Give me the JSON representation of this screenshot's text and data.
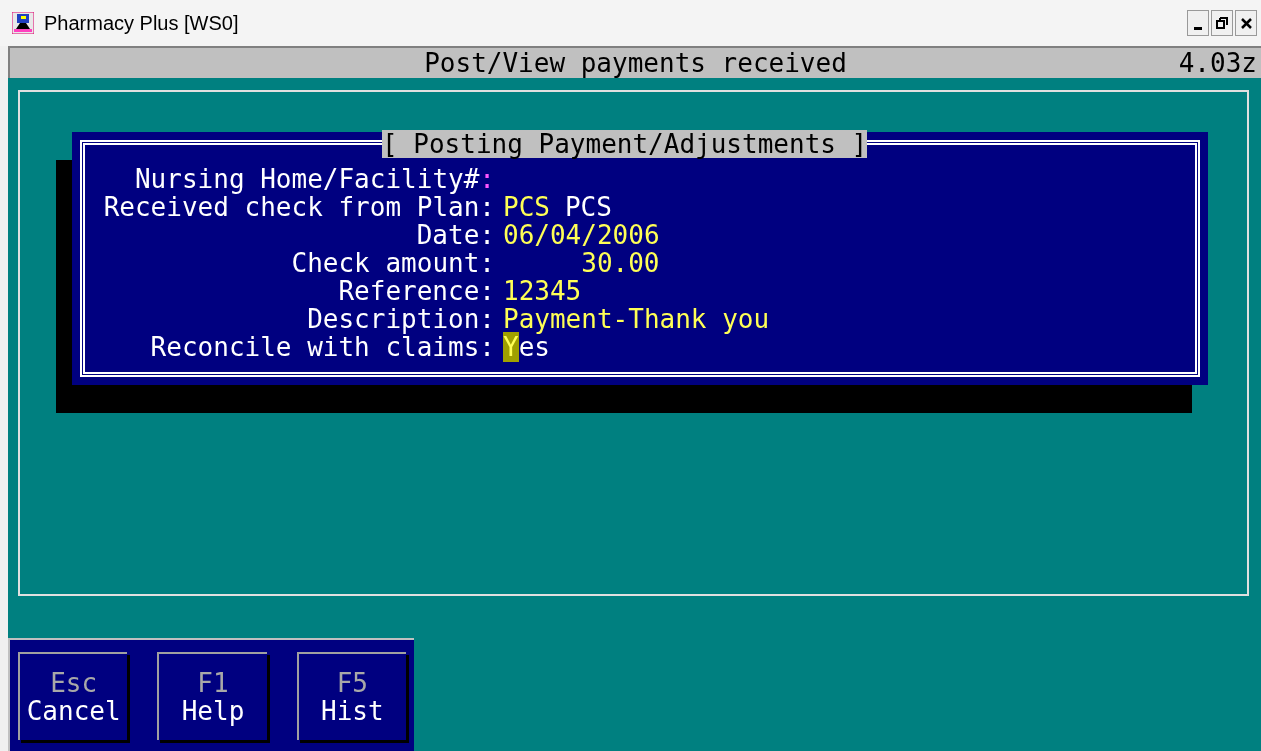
{
  "window": {
    "title": "Pharmacy Plus [WS0]"
  },
  "header": {
    "title": "Post/View payments received",
    "version": "4.03z"
  },
  "dialog": {
    "title": "[ Posting Payment/Adjustments ]",
    "fields": [
      {
        "label": "Nursing Home/Facility#:",
        "kind": "text",
        "current": true,
        "cursor": false
      },
      {
        "label": "Received check from Plan:",
        "kind": "plan",
        "value": "PCS",
        "value_name": "PCS",
        "current": false,
        "cursor": false
      },
      {
        "label": "Date:",
        "kind": "text",
        "value": "06/04/2006",
        "current": false,
        "cursor": false
      },
      {
        "label": "Check amount:",
        "kind": "amount",
        "value": "30.00",
        "current": false,
        "cursor": false
      },
      {
        "label": "Reference:",
        "kind": "text",
        "value": "12345",
        "current": false,
        "cursor": false
      },
      {
        "label": "Description:",
        "kind": "text",
        "value": "Payment-Thank you",
        "current": false,
        "cursor": false
      },
      {
        "label": "Reconcile with claims:",
        "kind": "text",
        "value": "Yes",
        "current": false,
        "cursor": true
      }
    ]
  },
  "keys": [
    {
      "key": "Esc",
      "label": "Cancel"
    },
    {
      "key": "F1",
      "label": "Help"
    },
    {
      "key": "F5",
      "label": "Hist"
    }
  ]
}
